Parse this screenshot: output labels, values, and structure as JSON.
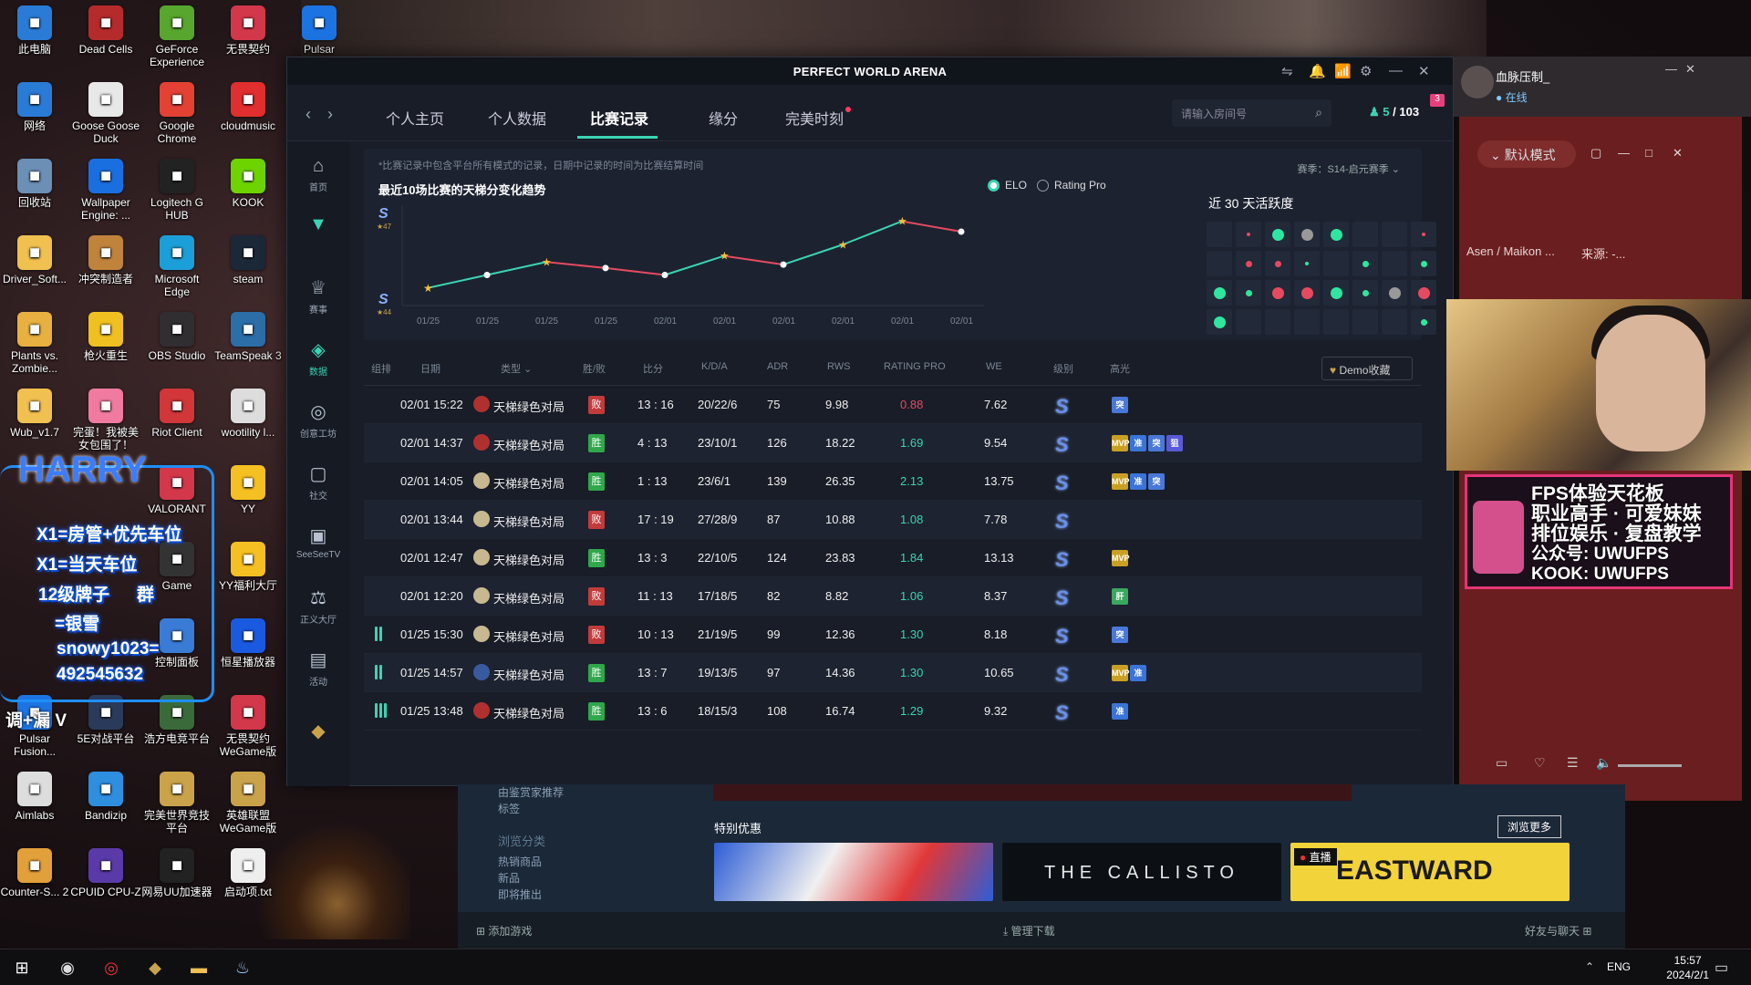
{
  "desktop_icons": [
    {
      "label": "此电脑",
      "icon": "computer-icon",
      "color": "#2a7bd6"
    },
    {
      "label": "Dead Cells",
      "icon": "dead-cells-icon",
      "color": "#b52b2b"
    },
    {
      "label": "GeForce Experience",
      "icon": "nvidia-icon",
      "color": "#58a62e"
    },
    {
      "label": "无畏契约",
      "icon": "valorant-icon",
      "color": "#d3374a"
    },
    {
      "label": "Pulsar",
      "icon": "pulsar-icon",
      "color": "#1c74e2"
    },
    {
      "label": "网络",
      "icon": "network-icon",
      "color": "#2a7bd6"
    },
    {
      "label": "Goose Goose Duck",
      "icon": "goose-icon",
      "color": "#e8e8e8"
    },
    {
      "label": "Google Chrome",
      "icon": "chrome-icon",
      "color": "#e34133"
    },
    {
      "label": "cloudmusic",
      "icon": "netease-music-icon",
      "color": "#e12e2e"
    },
    {
      "label": "回收站",
      "icon": "recycle-bin-icon",
      "color": "#6b8fb5"
    },
    {
      "label": "Wallpaper Engine: ...",
      "icon": "wallpaper-engine-icon",
      "color": "#1a6fe0"
    },
    {
      "label": "Logitech G HUB",
      "icon": "logitech-icon",
      "color": "#222"
    },
    {
      "label": "KOOK",
      "icon": "kook-icon",
      "color": "#6dd400"
    },
    {
      "label": "Driver_Soft...",
      "icon": "folder-icon",
      "color": "#f0c050"
    },
    {
      "label": "冲突制造者",
      "icon": "clash-icon",
      "color": "#c0833c"
    },
    {
      "label": "Microsoft Edge",
      "icon": "edge-icon",
      "color": "#1c9fd8"
    },
    {
      "label": "steam",
      "icon": "steam-icon",
      "color": "#1b2838"
    },
    {
      "label": "Plants vs. Zombie...",
      "icon": "pvz-icon",
      "color": "#e8b040"
    },
    {
      "label": "枪火重生",
      "icon": "gunfire-icon",
      "color": "#f0c020"
    },
    {
      "label": "OBS Studio",
      "icon": "obs-icon",
      "color": "#302e31"
    },
    {
      "label": "TeamSpeak 3",
      "icon": "teamspeak-icon",
      "color": "#2b6ea8"
    },
    {
      "label": "Wub_v1.7",
      "icon": "folder-icon",
      "color": "#f0c050"
    },
    {
      "label": "完蛋！我被美女包围了！",
      "icon": "game-icon",
      "color": "#f07aa0"
    },
    {
      "label": "Riot Client",
      "icon": "riot-icon",
      "color": "#d13639"
    },
    {
      "label": "wootility l...",
      "icon": "wootility-icon",
      "color": "#ddd"
    },
    {
      "label": "YY",
      "icon": "yy-icon",
      "color": "#f5c022"
    },
    {
      "label": "VALORANT",
      "icon": "valorant-icon",
      "color": "#d3374a"
    },
    {
      "label": "Game",
      "icon": "game-icon",
      "color": "#333"
    },
    {
      "label": "YY福利大厅",
      "icon": "yy-icon",
      "color": "#f5c022"
    },
    {
      "label": "控制面板",
      "icon": "control-panel-icon",
      "color": "#3a7bd5"
    },
    {
      "label": "恒星播放器",
      "icon": "player-icon",
      "color": "#1a5ae0"
    },
    {
      "label": "Pulsar Fusion...",
      "icon": "pulsar-icon",
      "color": "#1c74e2"
    },
    {
      "label": "5E对战平台",
      "icon": "5e-icon",
      "color": "#2a3a5a"
    },
    {
      "label": "浩方电竞平台",
      "icon": "haofang-icon",
      "color": "#3a6a3a"
    },
    {
      "label": "无畏契约 WeGame版",
      "icon": "valorant-icon",
      "color": "#d3374a"
    },
    {
      "label": "Aimlabs",
      "icon": "aimlabs-icon",
      "color": "#ddd"
    },
    {
      "label": "Bandizip",
      "icon": "bandizip-icon",
      "color": "#2e8ee0"
    },
    {
      "label": "完美世界竞技平台",
      "icon": "pw-icon",
      "color": "#c9a24a"
    },
    {
      "label": "英雄联盟 WeGame版",
      "icon": "lol-icon",
      "color": "#c9a24a"
    },
    {
      "label": "Counter-S... 2",
      "icon": "cs2-icon",
      "color": "#e2a03a"
    },
    {
      "label": "CPUID CPU-Z",
      "icon": "cpuz-icon",
      "color": "#5a3aa8"
    },
    {
      "label": "网易UU加速器",
      "icon": "uu-icon",
      "color": "#222"
    },
    {
      "label": "启动项.txt",
      "icon": "text-file-icon",
      "color": "#eee"
    }
  ],
  "overlay": {
    "title": "HARRY",
    "lines": [
      "X1=房管+优先车位",
      "X1=当天车位",
      "12级牌子",
      "群",
      "=银雪",
      "snowy1023=",
      "492545632",
      "调+漏 V"
    ]
  },
  "pw": {
    "title": "PERFECT WORLD ARENA",
    "tabs": [
      "个人主页",
      "个人数据",
      "比赛记录",
      "缘分",
      "完美时刻"
    ],
    "active_tab": 2,
    "search_placeholder": "请输入房间号",
    "friends_online": "5",
    "friends_total": "/ 103",
    "notif_badge": "3",
    "sidebar": [
      {
        "label": "首页",
        "icon": "home-icon"
      },
      {
        "label": "",
        "icon": "cs-logo-icon"
      },
      {
        "label": "赛事",
        "icon": "trophy-icon"
      },
      {
        "label": "数据",
        "icon": "data-icon"
      },
      {
        "label": "创意工坊",
        "icon": "workshop-icon"
      },
      {
        "label": "社交",
        "icon": "social-icon"
      },
      {
        "label": "SeeSeeTV",
        "icon": "tv-icon"
      },
      {
        "label": "正义大厅",
        "icon": "justice-icon"
      },
      {
        "label": "活动",
        "icon": "event-icon"
      },
      {
        "label": "",
        "icon": "pw-logo-icon"
      }
    ],
    "note": "*比赛记录中包含平台所有模式的记录，日期中记录的时间为比赛结算时间",
    "season": "赛季：S14-启元赛季",
    "chart_title": "最近10场比赛的天梯分变化趋势",
    "radio_elo": "ELO",
    "radio_rating": "Rating Pro",
    "rank_top": "47",
    "rank_bottom": "44",
    "activity_title": "近 30 天活跃度",
    "table_headers": {
      "group": "组排",
      "date": "日期",
      "type": "类型",
      "wl": "胜/败",
      "score": "比分",
      "kda": "K/D/A",
      "adr": "ADR",
      "rws": "RWS",
      "rating": "RATING PRO",
      "we": "WE",
      "level": "级别",
      "highlight": "高光",
      "demo": "Demo收藏"
    },
    "matches": [
      {
        "date": "02/01 15:22",
        "type": "天梯绿色对局",
        "map": "#b03030",
        "result": "败",
        "score": "13 : 16",
        "kda": "20/22/6",
        "adr": "75",
        "rws": "9.98",
        "rating": "0.88",
        "we": "7.62",
        "group": "",
        "highlights": [
          "突"
        ]
      },
      {
        "date": "02/01 14:37",
        "type": "天梯绿色对局",
        "map": "#b03030",
        "result": "胜",
        "score": "4 : 13",
        "kda": "23/10/1",
        "adr": "126",
        "rws": "18.22",
        "rating": "1.69",
        "we": "9.54",
        "group": "",
        "highlights": [
          "MVP",
          "准",
          "突",
          "狙"
        ]
      },
      {
        "date": "02/01 14:05",
        "type": "天梯绿色对局",
        "map": "#c8b890",
        "result": "胜",
        "score": "1 : 13",
        "kda": "23/6/1",
        "adr": "139",
        "rws": "26.35",
        "rating": "2.13",
        "we": "13.75",
        "group": "",
        "highlights": [
          "MVP",
          "准",
          "突"
        ]
      },
      {
        "date": "02/01 13:44",
        "type": "天梯绿色对局",
        "map": "#c8b890",
        "result": "败",
        "score": "17 : 19",
        "kda": "27/28/9",
        "adr": "87",
        "rws": "10.88",
        "rating": "1.08",
        "we": "7.78",
        "group": "",
        "highlights": []
      },
      {
        "date": "02/01 12:47",
        "type": "天梯绿色对局",
        "map": "#c8b890",
        "result": "胜",
        "score": "13 : 3",
        "kda": "22/10/5",
        "adr": "124",
        "rws": "23.83",
        "rating": "1.84",
        "we": "13.13",
        "group": "",
        "highlights": [
          "MVP"
        ]
      },
      {
        "date": "02/01 12:20",
        "type": "天梯绿色对局",
        "map": "#c8b890",
        "result": "败",
        "score": "11 : 13",
        "kda": "17/18/5",
        "adr": "82",
        "rws": "8.82",
        "rating": "1.06",
        "we": "8.37",
        "group": "",
        "highlights": [
          "肝"
        ]
      },
      {
        "date": "01/25 15:30",
        "type": "天梯绿色对局",
        "map": "#c8b890",
        "result": "败",
        "score": "10 : 13",
        "kda": "21/19/5",
        "adr": "99",
        "rws": "12.36",
        "rating": "1.30",
        "we": "8.18",
        "group": "2",
        "highlights": [
          "突"
        ]
      },
      {
        "date": "01/25 14:57",
        "type": "天梯绿色对局",
        "map": "#3a5aa0",
        "result": "胜",
        "score": "13 : 7",
        "kda": "19/13/5",
        "adr": "97",
        "rws": "14.36",
        "rating": "1.30",
        "we": "10.65",
        "group": "2",
        "highlights": [
          "MVP",
          "准"
        ]
      },
      {
        "date": "01/25 13:48",
        "type": "天梯绿色对局",
        "map": "#b03030",
        "result": "胜",
        "score": "13 : 6",
        "kda": "18/15/3",
        "adr": "108",
        "rws": "16.74",
        "rating": "1.29",
        "we": "9.32",
        "group": "3",
        "highlights": [
          "准"
        ]
      }
    ]
  },
  "chart_data": {
    "type": "line",
    "title": "最近10场比赛的天梯分变化趋势",
    "categories": [
      "01/25",
      "01/25",
      "01/25",
      "01/25",
      "02/01",
      "02/01",
      "02/01",
      "02/01",
      "02/01",
      "02/01"
    ],
    "values": [
      0.15,
      0.3,
      0.45,
      0.38,
      0.3,
      0.52,
      0.42,
      0.65,
      0.92,
      0.8
    ],
    "star_marks": [
      0,
      2,
      5,
      7,
      8
    ],
    "ylim": [
      0,
      1
    ],
    "colors": {
      "up": "#3ad4b4",
      "down": "#e64a5f"
    }
  },
  "activity": [
    {
      "s": "",
      "c": ""
    },
    {
      "s": "xs",
      "c": "#e64a5f"
    },
    {
      "s": "l",
      "c": "#2ee6a0"
    },
    {
      "s": "l",
      "c": "#999"
    },
    {
      "s": "l",
      "c": "#2ee6a0"
    },
    {
      "s": "",
      "c": ""
    },
    {
      "s": "",
      "c": ""
    },
    {
      "s": "xs",
      "c": "#e64a5f"
    },
    {
      "s": "",
      "c": ""
    },
    {
      "s": "s",
      "c": "#e64a5f"
    },
    {
      "s": "s",
      "c": "#e64a5f"
    },
    {
      "s": "xs",
      "c": "#2ee6a0"
    },
    {
      "s": "",
      "c": ""
    },
    {
      "s": "s",
      "c": "#2ee6a0"
    },
    {
      "s": "",
      "c": ""
    },
    {
      "s": "s",
      "c": "#2ee6a0"
    },
    {
      "s": "l",
      "c": "#2ee6a0"
    },
    {
      "s": "s",
      "c": "#2ee6a0"
    },
    {
      "s": "l",
      "c": "#e64a5f"
    },
    {
      "s": "l",
      "c": "#e64a5f"
    },
    {
      "s": "l",
      "c": "#2ee6a0"
    },
    {
      "s": "s",
      "c": "#2ee6a0"
    },
    {
      "s": "l",
      "c": "#999"
    },
    {
      "s": "l",
      "c": "#e64a5f"
    },
    {
      "s": "l",
      "c": "#2ee6a0"
    },
    {
      "s": "",
      "c": ""
    },
    {
      "s": "",
      "c": ""
    },
    {
      "s": "",
      "c": ""
    },
    {
      "s": "",
      "c": ""
    },
    {
      "s": "",
      "c": ""
    },
    {
      "s": "",
      "c": ""
    },
    {
      "s": "s",
      "c": "#2ee6a0"
    }
  ],
  "stream": {
    "name": "血脉压制_",
    "status": "在线",
    "mode": "默认模式",
    "info1": "Asen / Maikon ...",
    "info2": "来源: -...",
    "promo": [
      "FPS体验天花板",
      "职业高手 · 可爱妹妹",
      "排位娱乐 · 复盘教学",
      "公众号: UWUFPS",
      "KOOK: UWUFPS"
    ]
  },
  "store": {
    "side": [
      "由鉴赏家推荐",
      "标签",
      "浏览分类",
      "热销商品",
      "新品",
      "即将推出"
    ],
    "special": "特别优惠",
    "browse_more": "浏览更多",
    "live": "直播",
    "add_game": "添加游戏",
    "manage_dl": "管理下载",
    "friends_chat": "好友与聊天",
    "callisto": "THE CALLISTO",
    "eastward": "EASTWARD"
  },
  "taskbar": {
    "lang": "ENG",
    "time": "15:57",
    "date": "2024/2/1"
  }
}
